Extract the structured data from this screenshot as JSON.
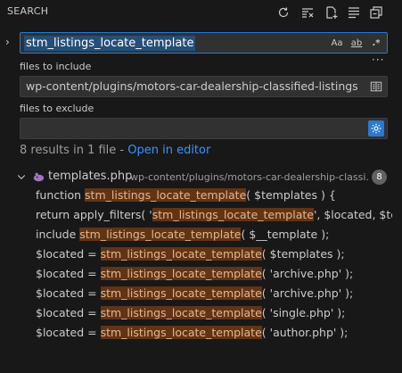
{
  "header": {
    "title": "SEARCH"
  },
  "toolbar": {
    "icons": [
      "refresh-icon",
      "clear-results-icon",
      "new-search-editor-icon",
      "view-as-tree-icon",
      "collapse-all-icon"
    ]
  },
  "search": {
    "query": "stm_listings_locate_template",
    "options": {
      "match_case": "Aa",
      "whole_word": "ab",
      "regex": ".*"
    }
  },
  "more_label": "···",
  "include": {
    "label": "files to include",
    "value": "wp-content/plugins/motors-car-dealership-classified-listings"
  },
  "exclude": {
    "label": "files to exclude",
    "value": ""
  },
  "summary": {
    "text": "8 results in 1 file - ",
    "link": "Open in editor"
  },
  "file": {
    "name": "templates.php",
    "path": "wp-content/plugins/motors-car-dealership-classi...",
    "count": "8"
  },
  "matches": [
    {
      "before": "function ",
      "match": "stm_listings_locate_template",
      "after": "( $templates ) {"
    },
    {
      "before": "return apply_filters( '",
      "match": "stm_listings_locate_template",
      "after": "', $located, $te..."
    },
    {
      "before": "include ",
      "match": "stm_listings_locate_template",
      "after": "( $__template );"
    },
    {
      "before": "$located = ",
      "match": "stm_listings_locate_template",
      "after": "( $templates );"
    },
    {
      "before": "$located = ",
      "match": "stm_listings_locate_template",
      "after": "( 'archive.php' );"
    },
    {
      "before": "$located = ",
      "match": "stm_listings_locate_template",
      "after": "( 'archive.php' );"
    },
    {
      "before": "$located = ",
      "match": "stm_listings_locate_template",
      "after": "( 'single.php' );"
    },
    {
      "before": "$located = ",
      "match": "stm_listings_locate_template",
      "after": "( 'author.php' );"
    }
  ],
  "colors": {
    "background": "#181818",
    "focus_border": "#2b79d0",
    "match_highlight": "#623315",
    "link": "#3794ff"
  }
}
